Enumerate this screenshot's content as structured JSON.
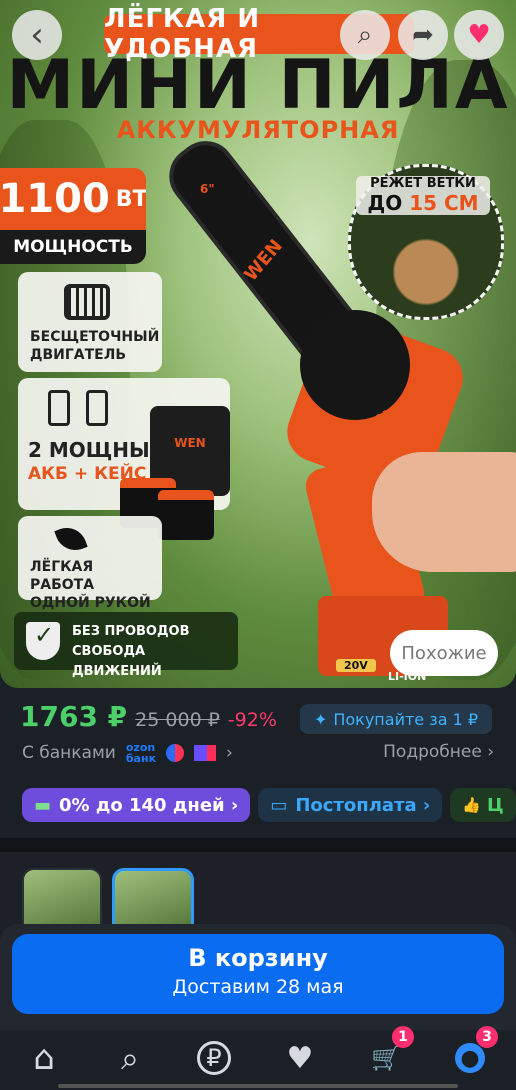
{
  "hero": {
    "banner": "ЛЁГКАЯ И УДОБНАЯ",
    "title": "МИНИ ПИЛА",
    "subtitle": "АККУМУЛЯТОРНАЯ",
    "power_value": "1100",
    "power_unit": "ВТ",
    "power_label": "МОЩНОСТЬ",
    "cut_line1": "РЕЖЕТ ВЕТКИ",
    "cut_prefix": "ДО",
    "cut_value": "15 СМ",
    "card1": "БЕСЩЕТОЧНЫЙ ДВИГАТЕЛЬ",
    "card2_line1": "2 МОЩНЫХ",
    "card2_line2": "АКБ + КЕЙС",
    "card3": "ЛЁГКАЯ РАБОТА ОДНОЙ РУКОЙ",
    "nocord_line1": "БЕЗ ПРОВОДОВ",
    "nocord_line2": "СВОБОДА ДВИЖЕНИЙ",
    "brand": "WEN",
    "battery_voltage": "20V",
    "battery_type": "LI-ION",
    "bar_size": "6\"",
    "similar_button": "Похожие"
  },
  "nav": {
    "back_icon": "‹",
    "search_icon": "⌕",
    "share_icon": "➦",
    "favorite_icon": "♥"
  },
  "price": {
    "current": "1763 ₽",
    "old": "25 000 ₽",
    "discount": "-92%",
    "promo": "Покупайте за 1 ₽",
    "promo_icon": "✦",
    "banks_label": "С банками",
    "ozon_bank_line1": "ozon",
    "ozon_bank_line2": "банк",
    "details_link": "Подробнее ›",
    "banks_chevron": "›"
  },
  "chips": [
    {
      "label": "0% до 140 дней ›",
      "icon": "▬"
    },
    {
      "label": "Постоплата ›",
      "icon": "▭"
    },
    {
      "label": "Ц",
      "icon": "👍"
    }
  ],
  "cart": {
    "button_label": "В корзину",
    "delivery": "Доставим 28 мая"
  },
  "tabbar": {
    "home_icon": "⌂",
    "search_icon": "⌕",
    "ruble_icon": "₽",
    "favorites_icon": "♥",
    "cart_icon": "🛒",
    "profile_icon": "●",
    "cart_badge": "1",
    "profile_badge": "3"
  },
  "colors": {
    "accent_orange": "#e8541b",
    "price_green": "#4cd06a",
    "discount_pink": "#ff3a6e",
    "cart_blue": "#0a6cf0",
    "badge_pink": "#ff2e6e"
  }
}
